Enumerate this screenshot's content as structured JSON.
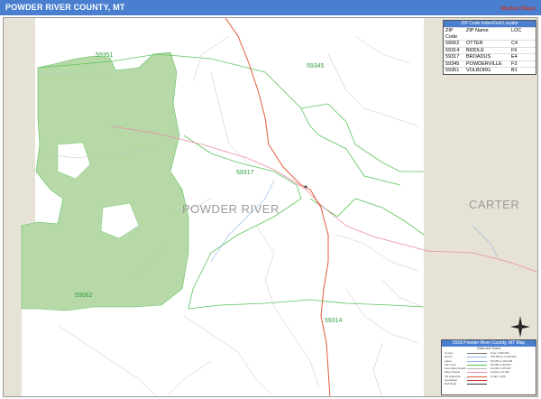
{
  "title": "POWDER RIVER COUNTY, MT",
  "brand": "Market Maps",
  "counties": {
    "main": "POWDER RIVER",
    "neighbor": "CARTER"
  },
  "zip_labels": [
    "59351",
    "59345",
    "59317",
    "59062",
    "59314"
  ],
  "zip_table": {
    "title": "ZIP Code Index/Grid Locator",
    "headers": [
      "ZIP Code",
      "ZIP Name",
      "LOC"
    ],
    "rows": [
      [
        "59062",
        "OTTER",
        "C4"
      ],
      [
        "59314",
        "BIDDLE",
        "F6"
      ],
      [
        "59317",
        "BROADUS",
        "E4"
      ],
      [
        "59345",
        "POWDERVILLE",
        "F3"
      ],
      [
        "59351",
        "VOLBORG",
        "B1"
      ]
    ]
  },
  "legend": {
    "title": "2018 Powder River County, MT Map",
    "subtitle": "Cities and Towns",
    "rows": [
      {
        "label": "County",
        "right": "Over 1,000,000"
      },
      {
        "label": "Rivers",
        "right": "100,000 to 1,000,000"
      },
      {
        "label": "Lakes",
        "right": "50,000 to 100,000"
      },
      {
        "label": "ZIP Code",
        "right": "25,000 to 50,000"
      },
      {
        "label": "Secondary Roads",
        "right": "10,000 to 25,000"
      },
      {
        "label": "Major Roads",
        "right": "1,000 to 10,000"
      },
      {
        "label": "US Highways",
        "right": "Under 1,000"
      },
      {
        "label": "Interstates",
        "right": ""
      },
      {
        "label": "Rail Road",
        "right": ""
      }
    ]
  },
  "colors": {
    "title_bar": "#4a7fd0",
    "zip_boundary": "#5cc35c",
    "national_forest": "#b7d9a8",
    "outside_county": "#e6e2d6",
    "highway": "#e05a3a",
    "secondary_road": "#e98ea5",
    "local_road": "#b5b5b5",
    "water": "#8fb6e6"
  }
}
